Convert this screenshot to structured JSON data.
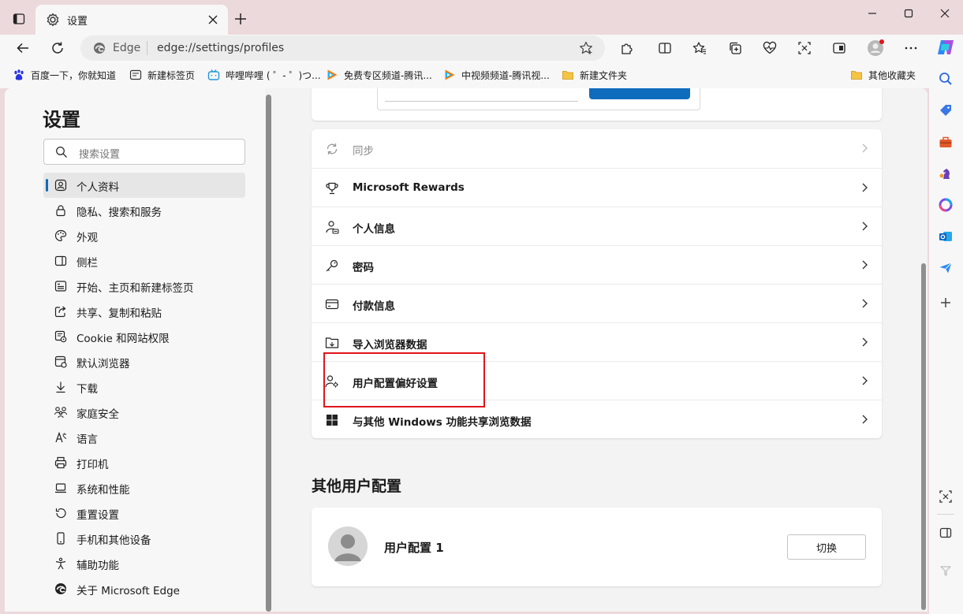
{
  "window": {
    "tab_title": "设置",
    "new_tab_symbol": "+"
  },
  "toolbar": {
    "address_brand": "Edge",
    "address_url": "edge://settings/profiles"
  },
  "bookmarks": [
    {
      "label": "百度一下，你就知道",
      "icon": "baidu-icon"
    },
    {
      "label": "新建标签页",
      "icon": "newtab-icon"
    },
    {
      "label": "哔哩哔哩 ( ゜- ゜)つ...",
      "icon": "bilibili-icon"
    },
    {
      "label": "免费专区频道-腾讯...",
      "icon": "tencent-video-icon"
    },
    {
      "label": "中视频频道-腾讯视...",
      "icon": "tencent-video-icon"
    },
    {
      "label": "新建文件夹",
      "icon": "folder-icon"
    },
    {
      "label": "其他收藏夹",
      "icon": "folder-icon"
    }
  ],
  "settings_nav": {
    "title": "设置",
    "search_placeholder": "搜索设置",
    "items": [
      {
        "label": "个人资料",
        "icon": "profile-icon",
        "active": true
      },
      {
        "label": "隐私、搜索和服务",
        "icon": "lock-icon"
      },
      {
        "label": "外观",
        "icon": "palette-icon"
      },
      {
        "label": "侧栏",
        "icon": "sidebar-icon"
      },
      {
        "label": "开始、主页和新建标签页",
        "icon": "home-icon"
      },
      {
        "label": "共享、复制和粘贴",
        "icon": "share-icon"
      },
      {
        "label": "Cookie 和网站权限",
        "icon": "cookie-icon"
      },
      {
        "label": "默认浏览器",
        "icon": "browser-icon"
      },
      {
        "label": "下载",
        "icon": "download-icon"
      },
      {
        "label": "家庭安全",
        "icon": "family-icon"
      },
      {
        "label": "语言",
        "icon": "language-icon"
      },
      {
        "label": "打印机",
        "icon": "printer-icon"
      },
      {
        "label": "系统和性能",
        "icon": "laptop-icon"
      },
      {
        "label": "重置设置",
        "icon": "reset-icon"
      },
      {
        "label": "手机和其他设备",
        "icon": "phone-icon"
      },
      {
        "label": "辅助功能",
        "icon": "accessibility-icon"
      },
      {
        "label": "关于 Microsoft Edge",
        "icon": "edge-icon"
      }
    ]
  },
  "profile_settings": {
    "rows": [
      {
        "label": "同步",
        "icon": "sync-icon",
        "disabled": true
      },
      {
        "label": "Microsoft Rewards",
        "icon": "trophy-icon"
      },
      {
        "label": "个人信息",
        "icon": "person-info-icon"
      },
      {
        "label": "密码",
        "icon": "key-icon"
      },
      {
        "label": "付款信息",
        "icon": "card-icon"
      },
      {
        "label": "导入浏览器数据",
        "icon": "import-icon"
      },
      {
        "label": "用户配置偏好设置",
        "icon": "profile-settings-icon"
      },
      {
        "label": "与其他 Windows 功能共享浏览数据",
        "icon": "windows-icon"
      }
    ]
  },
  "other_profiles": {
    "title": "其他用户配置",
    "profile_name": "用户配置 1",
    "switch_label": "切换"
  },
  "colors": {
    "accent": "#0f6cbd",
    "highlight_box": "#e0141c",
    "chrome": "#ecd9dc"
  }
}
